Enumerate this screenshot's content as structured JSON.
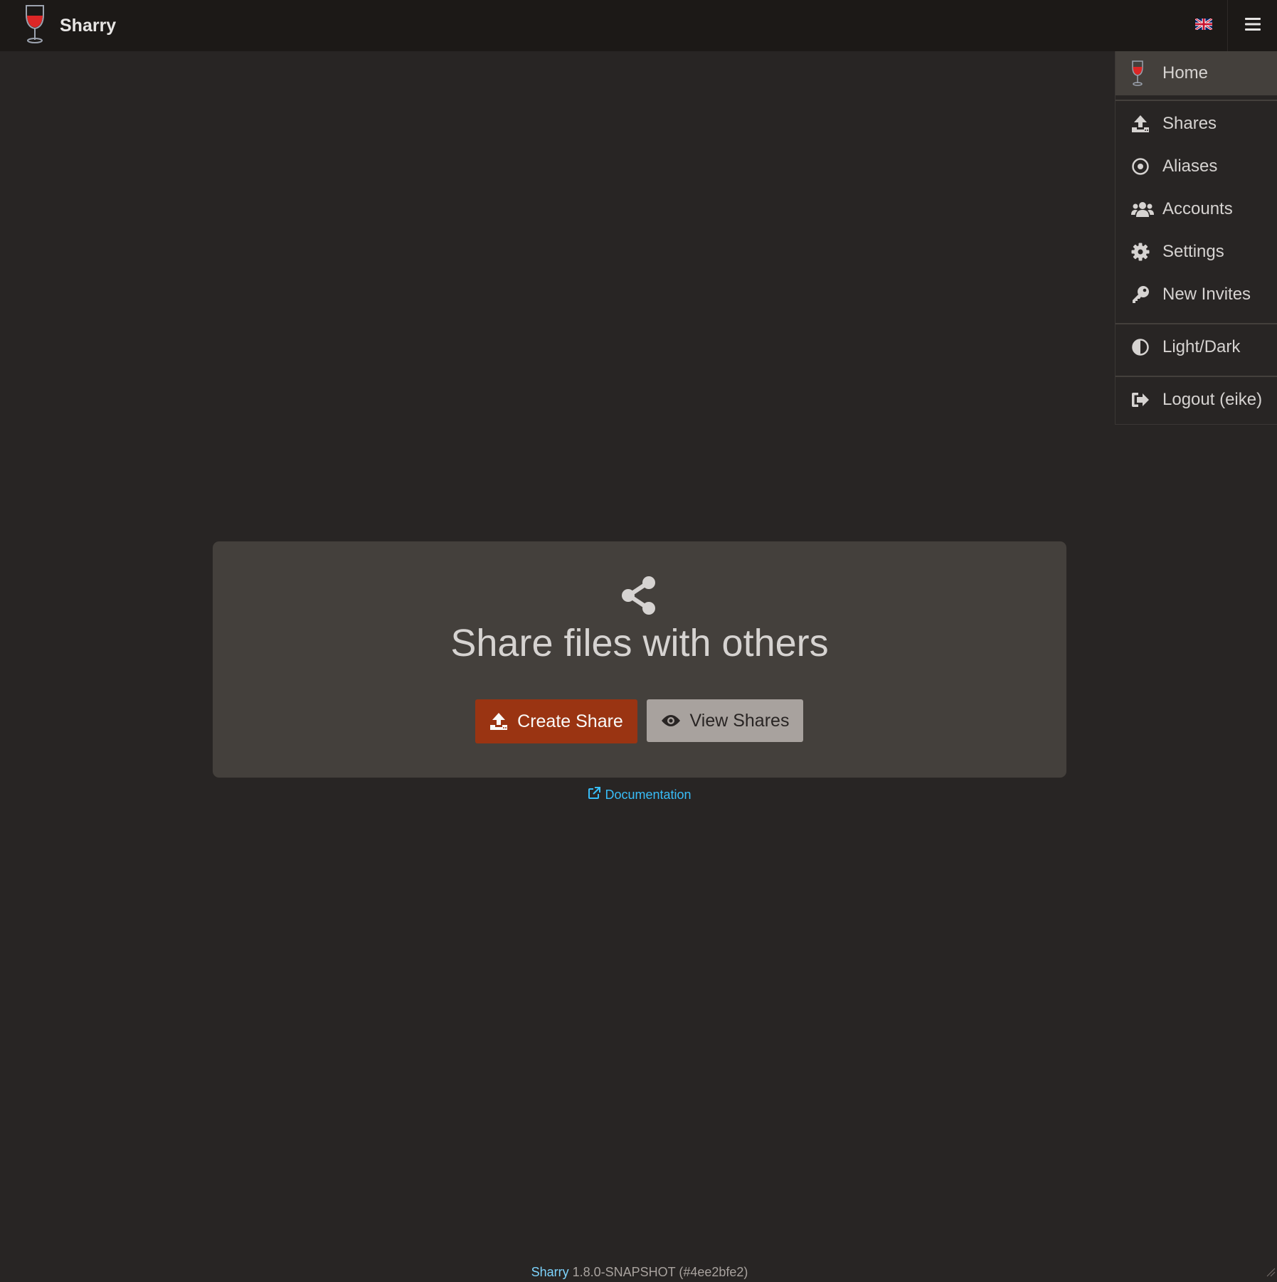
{
  "app": {
    "name": "Sharry"
  },
  "menu": {
    "items": [
      {
        "id": "home",
        "label": "Home",
        "icon": "wine-glass-icon",
        "active": true
      },
      {
        "id": "shares",
        "label": "Shares",
        "icon": "upload-icon"
      },
      {
        "id": "aliases",
        "label": "Aliases",
        "icon": "dot-circle-icon"
      },
      {
        "id": "accounts",
        "label": "Accounts",
        "icon": "users-icon"
      },
      {
        "id": "settings",
        "label": "Settings",
        "icon": "gear-icon"
      },
      {
        "id": "new-invites",
        "label": "New Invites",
        "icon": "key-icon"
      },
      {
        "id": "light-dark",
        "label": "Light/Dark",
        "icon": "half-circle-icon"
      },
      {
        "id": "logout",
        "label": "Logout (eike)",
        "icon": "sign-out-icon"
      }
    ]
  },
  "main": {
    "title": "Share files with others",
    "create_label": "Create Share",
    "view_label": "View Shares",
    "doc_label": "Documentation"
  },
  "footer": {
    "app_name": "Sharry",
    "version": "1.8.0-SNAPSHOT (#4ee2bfe2)"
  },
  "colors": {
    "background": "#282524",
    "topbar": "#1c1917",
    "card": "#44403c",
    "primary_button": "#9a3412",
    "secondary_button": "#a8a29e",
    "link": "#38bdf8"
  }
}
